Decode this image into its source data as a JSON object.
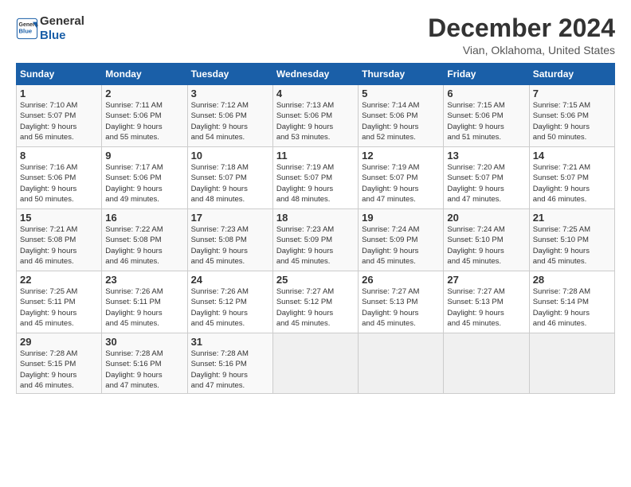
{
  "header": {
    "logo_line1": "General",
    "logo_line2": "Blue",
    "title": "December 2024",
    "location": "Vian, Oklahoma, United States"
  },
  "days_of_week": [
    "Sunday",
    "Monday",
    "Tuesday",
    "Wednesday",
    "Thursday",
    "Friday",
    "Saturday"
  ],
  "weeks": [
    [
      {
        "day": "1",
        "info": "Sunrise: 7:10 AM\nSunset: 5:07 PM\nDaylight: 9 hours\nand 56 minutes."
      },
      {
        "day": "2",
        "info": "Sunrise: 7:11 AM\nSunset: 5:06 PM\nDaylight: 9 hours\nand 55 minutes."
      },
      {
        "day": "3",
        "info": "Sunrise: 7:12 AM\nSunset: 5:06 PM\nDaylight: 9 hours\nand 54 minutes."
      },
      {
        "day": "4",
        "info": "Sunrise: 7:13 AM\nSunset: 5:06 PM\nDaylight: 9 hours\nand 53 minutes."
      },
      {
        "day": "5",
        "info": "Sunrise: 7:14 AM\nSunset: 5:06 PM\nDaylight: 9 hours\nand 52 minutes."
      },
      {
        "day": "6",
        "info": "Sunrise: 7:15 AM\nSunset: 5:06 PM\nDaylight: 9 hours\nand 51 minutes."
      },
      {
        "day": "7",
        "info": "Sunrise: 7:15 AM\nSunset: 5:06 PM\nDaylight: 9 hours\nand 50 minutes."
      }
    ],
    [
      {
        "day": "8",
        "info": "Sunrise: 7:16 AM\nSunset: 5:06 PM\nDaylight: 9 hours\nand 50 minutes."
      },
      {
        "day": "9",
        "info": "Sunrise: 7:17 AM\nSunset: 5:06 PM\nDaylight: 9 hours\nand 49 minutes."
      },
      {
        "day": "10",
        "info": "Sunrise: 7:18 AM\nSunset: 5:07 PM\nDaylight: 9 hours\nand 48 minutes."
      },
      {
        "day": "11",
        "info": "Sunrise: 7:19 AM\nSunset: 5:07 PM\nDaylight: 9 hours\nand 48 minutes."
      },
      {
        "day": "12",
        "info": "Sunrise: 7:19 AM\nSunset: 5:07 PM\nDaylight: 9 hours\nand 47 minutes."
      },
      {
        "day": "13",
        "info": "Sunrise: 7:20 AM\nSunset: 5:07 PM\nDaylight: 9 hours\nand 47 minutes."
      },
      {
        "day": "14",
        "info": "Sunrise: 7:21 AM\nSunset: 5:07 PM\nDaylight: 9 hours\nand 46 minutes."
      }
    ],
    [
      {
        "day": "15",
        "info": "Sunrise: 7:21 AM\nSunset: 5:08 PM\nDaylight: 9 hours\nand 46 minutes."
      },
      {
        "day": "16",
        "info": "Sunrise: 7:22 AM\nSunset: 5:08 PM\nDaylight: 9 hours\nand 46 minutes."
      },
      {
        "day": "17",
        "info": "Sunrise: 7:23 AM\nSunset: 5:08 PM\nDaylight: 9 hours\nand 45 minutes."
      },
      {
        "day": "18",
        "info": "Sunrise: 7:23 AM\nSunset: 5:09 PM\nDaylight: 9 hours\nand 45 minutes."
      },
      {
        "day": "19",
        "info": "Sunrise: 7:24 AM\nSunset: 5:09 PM\nDaylight: 9 hours\nand 45 minutes."
      },
      {
        "day": "20",
        "info": "Sunrise: 7:24 AM\nSunset: 5:10 PM\nDaylight: 9 hours\nand 45 minutes."
      },
      {
        "day": "21",
        "info": "Sunrise: 7:25 AM\nSunset: 5:10 PM\nDaylight: 9 hours\nand 45 minutes."
      }
    ],
    [
      {
        "day": "22",
        "info": "Sunrise: 7:25 AM\nSunset: 5:11 PM\nDaylight: 9 hours\nand 45 minutes."
      },
      {
        "day": "23",
        "info": "Sunrise: 7:26 AM\nSunset: 5:11 PM\nDaylight: 9 hours\nand 45 minutes."
      },
      {
        "day": "24",
        "info": "Sunrise: 7:26 AM\nSunset: 5:12 PM\nDaylight: 9 hours\nand 45 minutes."
      },
      {
        "day": "25",
        "info": "Sunrise: 7:27 AM\nSunset: 5:12 PM\nDaylight: 9 hours\nand 45 minutes."
      },
      {
        "day": "26",
        "info": "Sunrise: 7:27 AM\nSunset: 5:13 PM\nDaylight: 9 hours\nand 45 minutes."
      },
      {
        "day": "27",
        "info": "Sunrise: 7:27 AM\nSunset: 5:13 PM\nDaylight: 9 hours\nand 45 minutes."
      },
      {
        "day": "28",
        "info": "Sunrise: 7:28 AM\nSunset: 5:14 PM\nDaylight: 9 hours\nand 46 minutes."
      }
    ],
    [
      {
        "day": "29",
        "info": "Sunrise: 7:28 AM\nSunset: 5:15 PM\nDaylight: 9 hours\nand 46 minutes."
      },
      {
        "day": "30",
        "info": "Sunrise: 7:28 AM\nSunset: 5:16 PM\nDaylight: 9 hours\nand 47 minutes."
      },
      {
        "day": "31",
        "info": "Sunrise: 7:28 AM\nSunset: 5:16 PM\nDaylight: 9 hours\nand 47 minutes."
      },
      {
        "day": "",
        "info": ""
      },
      {
        "day": "",
        "info": ""
      },
      {
        "day": "",
        "info": ""
      },
      {
        "day": "",
        "info": ""
      }
    ]
  ]
}
